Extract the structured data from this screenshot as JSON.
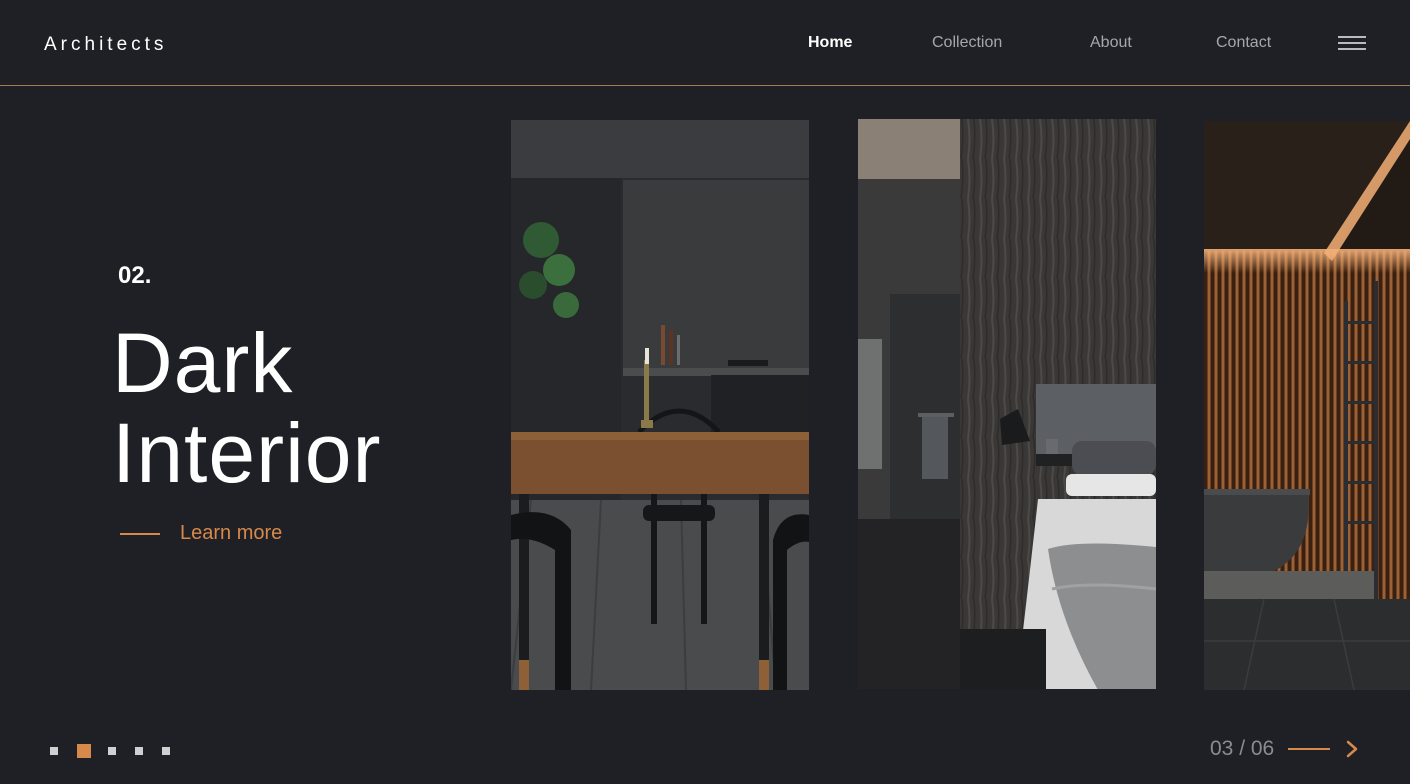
{
  "brand": "Architects",
  "nav": [
    {
      "label": "Home",
      "active": true
    },
    {
      "label": "Collection",
      "active": false
    },
    {
      "label": "About",
      "active": false
    },
    {
      "label": "Contact",
      "active": false
    }
  ],
  "hero": {
    "number": "02.",
    "title_line1": "Dark",
    "title_line2": "Interior",
    "cta": "Learn more"
  },
  "gallery": [
    {
      "name": "dark-dining-room-photo"
    },
    {
      "name": "dark-bedroom-photo"
    },
    {
      "name": "wood-bathroom-photo"
    }
  ],
  "pagination": {
    "dots": 5,
    "active_dot": 2,
    "counter": "03 / 06"
  },
  "colors": {
    "background": "#1f2025",
    "accent": "#d6894a",
    "divider": "#a67c4e",
    "muted_text": "#a6a7ab"
  },
  "icons": {
    "menu": "hamburger-menu-icon",
    "next": "chevron-right-icon"
  }
}
